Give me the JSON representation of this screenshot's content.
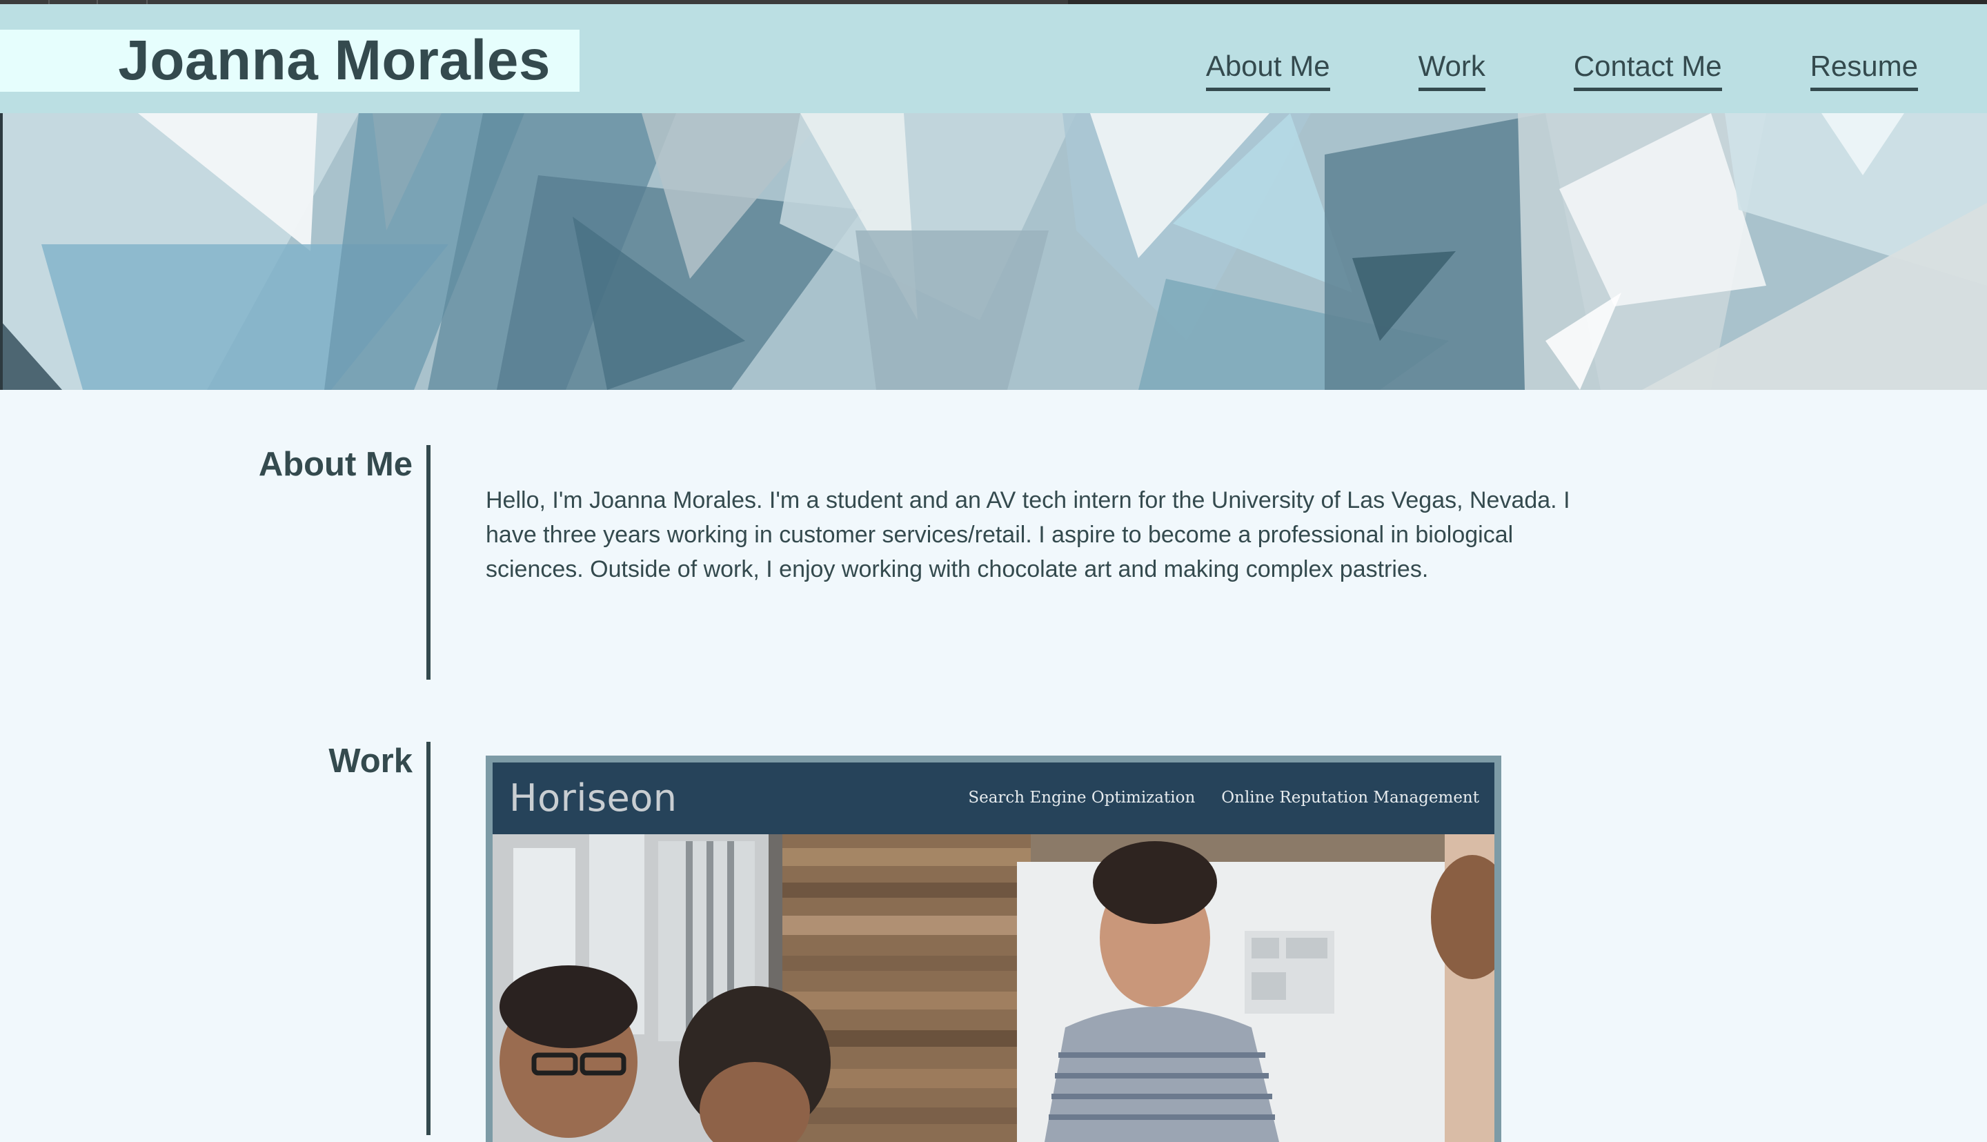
{
  "header": {
    "name": "Joanna Morales",
    "nav": [
      "About Me",
      "Work",
      "Contact Me",
      "Resume"
    ]
  },
  "about": {
    "heading": "About Me",
    "text": "Hello, I'm Joanna Morales. I'm a student and an AV tech intern for the University of Las Vegas, Nevada. I have three years working in customer services/retail. I aspire to become a professional in biological sciences. Outside of work, I enjoy working with chocolate art and making complex pastries."
  },
  "work": {
    "heading": "Work",
    "project": {
      "logo": "Horiseon",
      "links": [
        "Search Engine Optimization",
        "Online Reputation Management"
      ]
    }
  },
  "colors": {
    "header_bg": "#bbdfe3",
    "name_box_bg": "#e6fefd",
    "text_dark": "#344a4e",
    "page_bg": "#f1f8fc",
    "project_header_bg": "#26435a"
  },
  "icons": [
    "hero-banner-image",
    "project-screenshot-image"
  ]
}
